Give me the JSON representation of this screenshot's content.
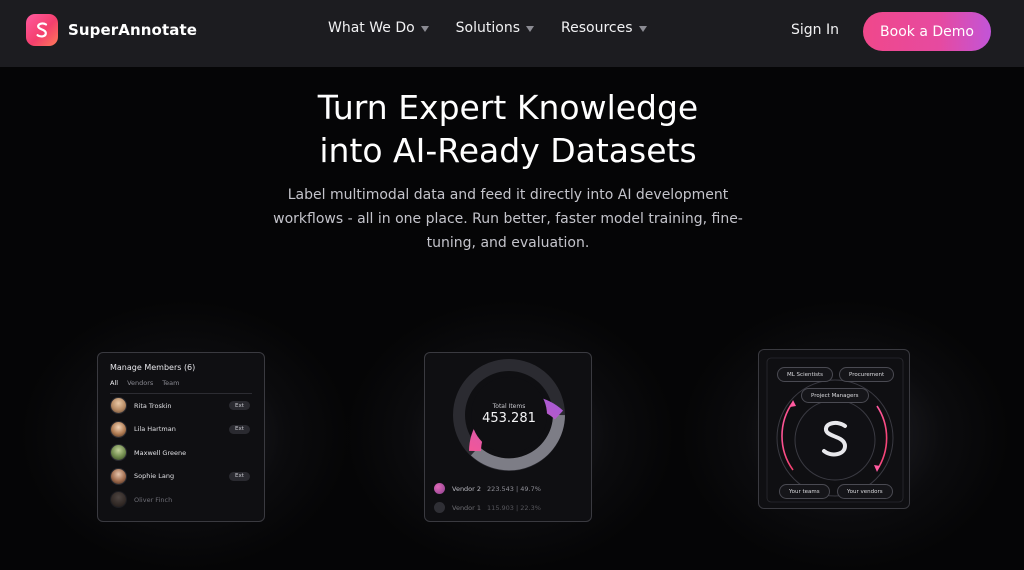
{
  "nav": {
    "brand": "SuperAnnotate",
    "menu": [
      {
        "label": "What We Do"
      },
      {
        "label": "Solutions"
      },
      {
        "label": "Resources"
      }
    ],
    "sign_in": "Sign In",
    "cta": "Book a Demo"
  },
  "hero": {
    "title_line1": "Turn Expert Knowledge",
    "title_line2": "into AI-Ready Datasets",
    "subtitle": "Label multimodal data and feed it directly into AI development workflows - all in one place. Run better, faster model training, fine-tuning, and evaluation."
  },
  "members_card": {
    "title": "Manage Members (6)",
    "tabs": [
      "All",
      "Vendors",
      "Team"
    ],
    "members": [
      {
        "name": "Rita Troskin",
        "badge": "Ext"
      },
      {
        "name": "Lila Hartman",
        "badge": "Ext"
      },
      {
        "name": "Maxwell Greene",
        "badge": ""
      },
      {
        "name": "Sophie Lang",
        "badge": "Ext"
      },
      {
        "name": "Oliver Finch",
        "badge": ""
      }
    ]
  },
  "items_card": {
    "label": "Total Items",
    "value": "453.281",
    "vendors": [
      {
        "name": "Vendor 2",
        "value": "223.543 | 49.7%",
        "color": "#b34fa0"
      },
      {
        "name": "Vendor 1",
        "value": "115.903 | 22.3%",
        "color": "#5a5a62"
      }
    ],
    "colors": {
      "arc_start": "#f0579a",
      "arc_end": "#a65bd6",
      "arc_gray": "#7d7d86"
    }
  },
  "workflow_card": {
    "roles": [
      "ML Scientists",
      "Procurement",
      "Project Managers",
      "Your teams",
      "Your vendors"
    ]
  }
}
